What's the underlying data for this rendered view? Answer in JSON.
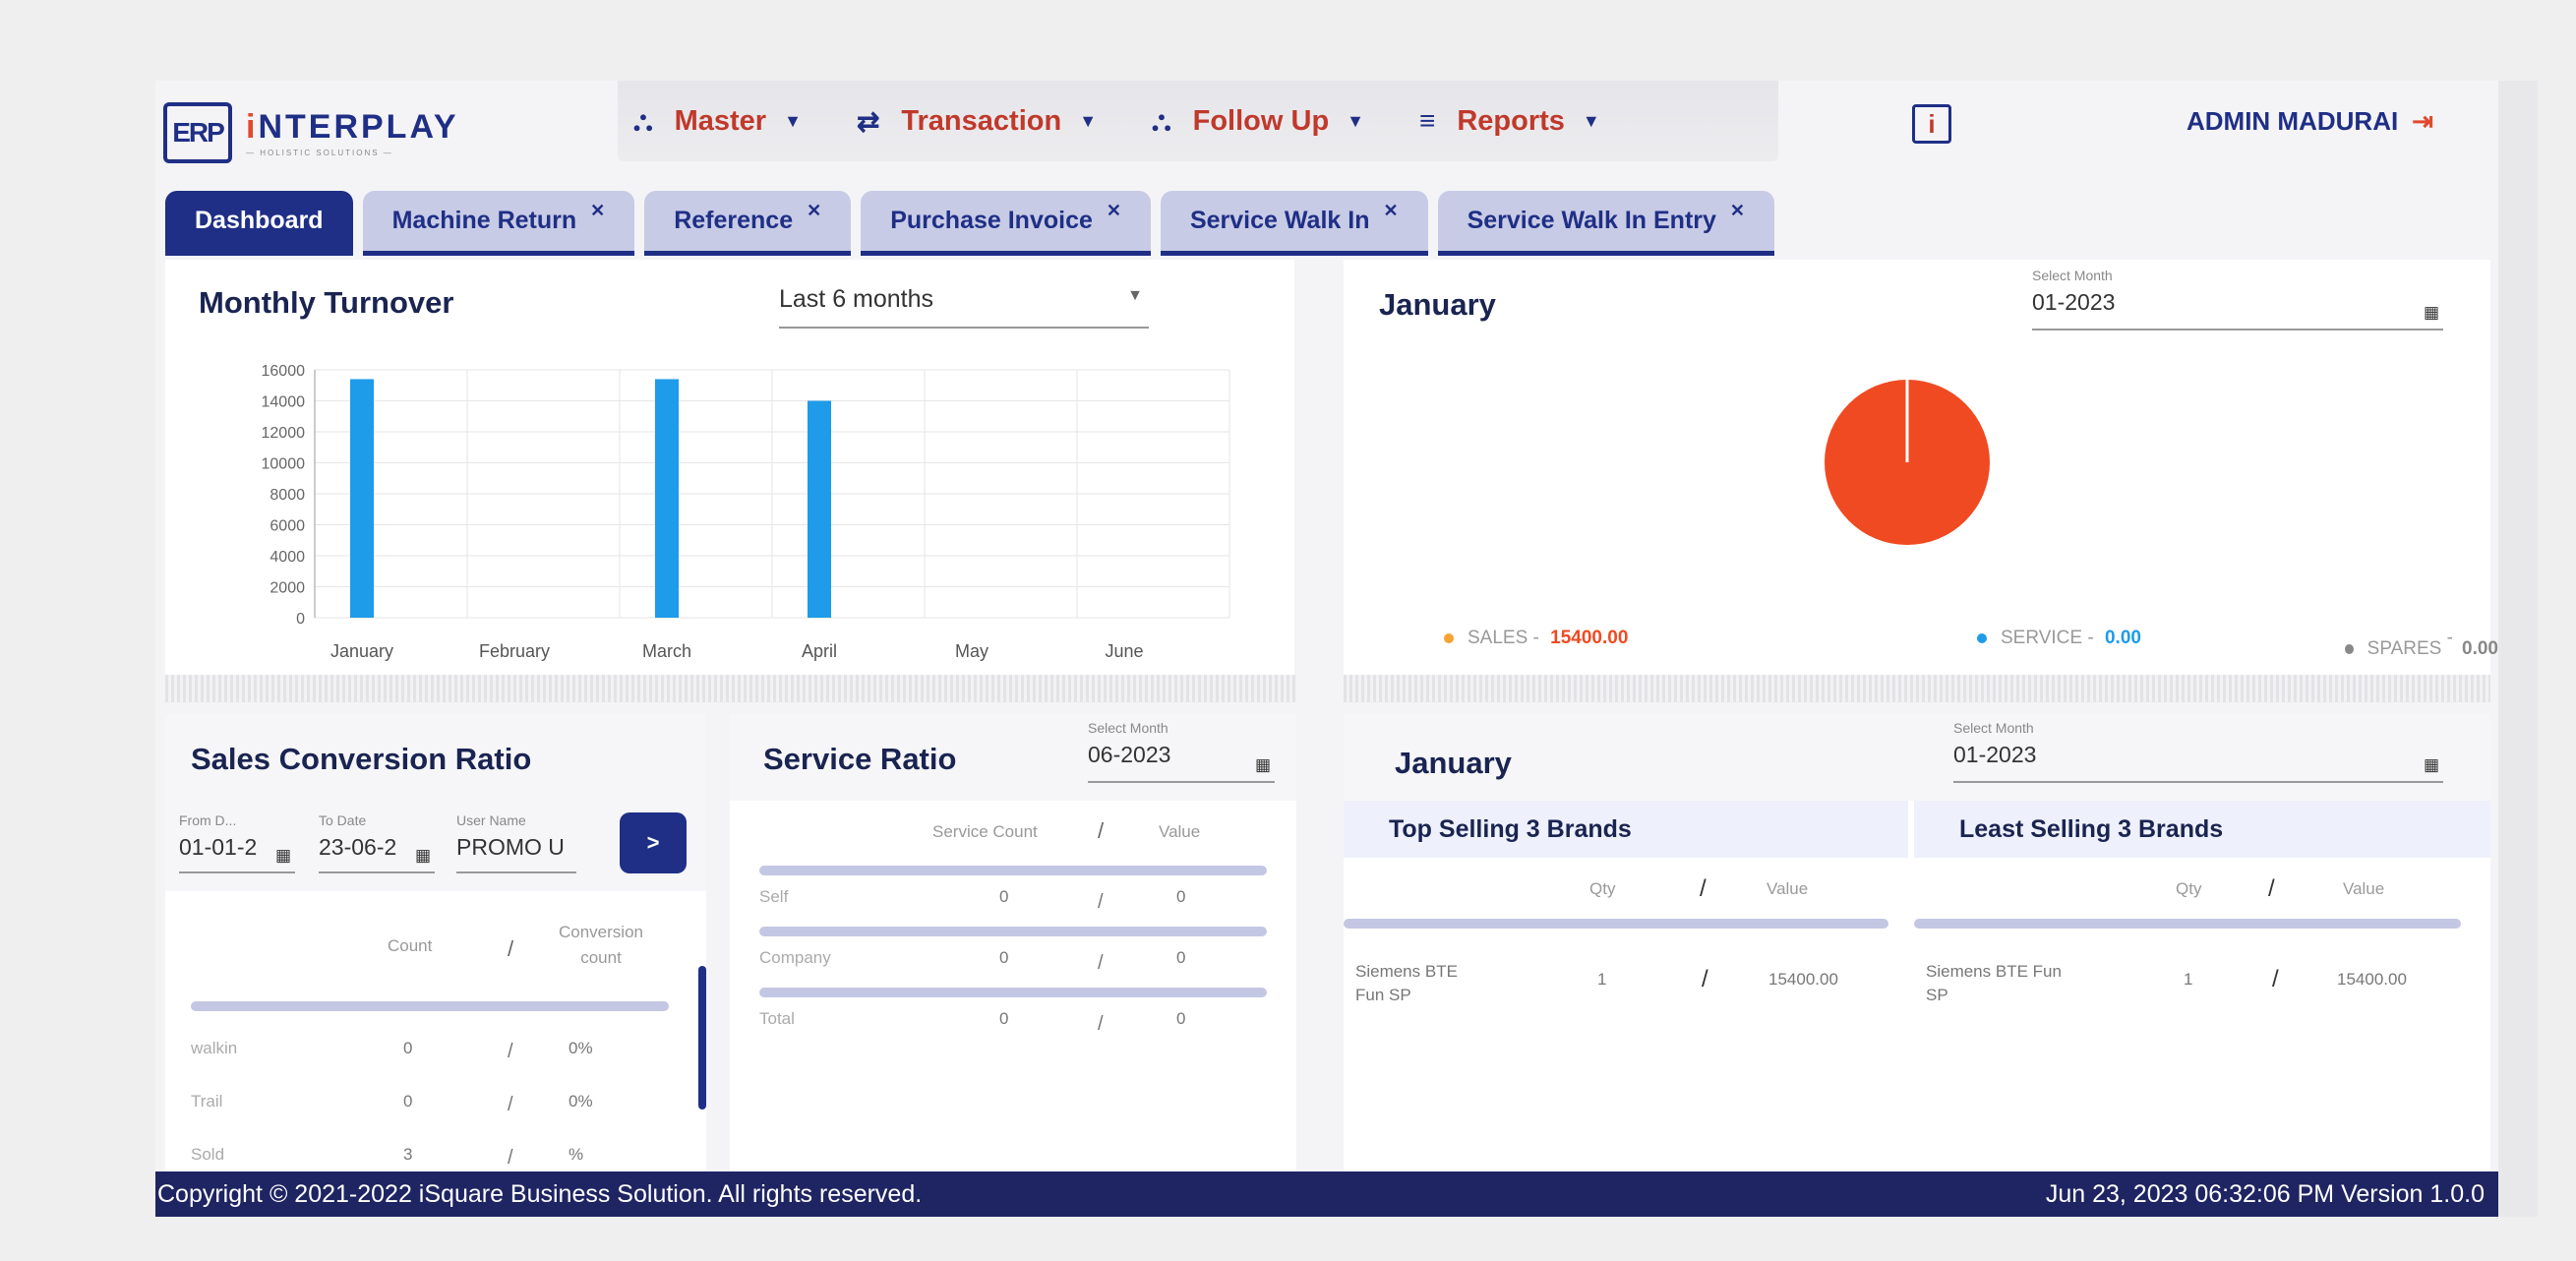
{
  "logo": {
    "name_pre": "i",
    "name_main": "NTERPLAY",
    "tagline": "— HOLISTIC SOLUTIONS —",
    "mark": "ERP"
  },
  "nav": [
    {
      "icon": "sitemap-icon",
      "glyph": "⛬",
      "label": "Master"
    },
    {
      "icon": "exchange-icon",
      "glyph": "⇄",
      "label": "Transaction"
    },
    {
      "icon": "sitemap-icon",
      "glyph": "⛬",
      "label": "Follow Up"
    },
    {
      "icon": "list-icon",
      "glyph": "≡",
      "label": "Reports"
    }
  ],
  "user": {
    "name": "ADMIN MADURAI"
  },
  "tabs": [
    {
      "label": "Dashboard",
      "active": true
    },
    {
      "label": "Machine Return"
    },
    {
      "label": "Reference"
    },
    {
      "label": "Purchase Invoice"
    },
    {
      "label": "Service Walk In"
    },
    {
      "label": "Service Walk In Entry"
    }
  ],
  "turnover": {
    "title": "Monthly Turnover",
    "period": "Last 6 months"
  },
  "chart_data": {
    "type": "bar",
    "categories": [
      "January",
      "February",
      "March",
      "April",
      "May",
      "June"
    ],
    "values": [
      15400,
      0,
      15400,
      14000,
      0,
      0
    ],
    "yticks": [
      0,
      2000,
      4000,
      6000,
      8000,
      10000,
      12000,
      14000,
      16000
    ],
    "ylim": [
      0,
      16000
    ],
    "color": "#1e9be9",
    "grid": true
  },
  "january_pie": {
    "title": "January",
    "month_label": "Select Month",
    "month": "01-2023",
    "slices": [
      {
        "name": "SALES",
        "value": "15400.00",
        "num": 15400,
        "color": "#f04a22",
        "dot": "#f7a233"
      },
      {
        "name": "SERVICE",
        "value": "0.00",
        "num": 0,
        "color": "#1e9be9",
        "dot": "#1e9be9"
      },
      {
        "name": "SPARES",
        "value": "0.00",
        "num": 0,
        "color": "#888888",
        "dot": "#888888"
      }
    ]
  },
  "sales_conversion": {
    "title": "Sales Conversion Ratio",
    "from_label": "From D...",
    "from_value": "01-01-2",
    "to_label": "To Date",
    "to_value": "23-06-2",
    "user_label": "User Name",
    "user_value": "PROMO U",
    "go": ">",
    "col_count": "Count",
    "col_sep": "/",
    "col_conv1": "Conversion",
    "col_conv2": "count",
    "rows": [
      {
        "name": "walkin",
        "count": "0",
        "conv": "0%"
      },
      {
        "name": "Trail",
        "count": "0",
        "conv": "0%"
      },
      {
        "name": "Sold",
        "count": "3",
        "conv": "%"
      }
    ]
  },
  "service_ratio": {
    "title": "Service Ratio",
    "month_label": "Select Month",
    "month": "06-2023",
    "col_count": "Service Count",
    "col_sep": "/",
    "col_value": "Value",
    "rows": [
      {
        "name": "Self",
        "count": "0",
        "value": "0"
      },
      {
        "name": "Company",
        "count": "0",
        "value": "0"
      },
      {
        "name": "Total",
        "count": "0",
        "value": "0"
      }
    ]
  },
  "brands": {
    "title": "January",
    "month_label": "Select Month",
    "month": "01-2023",
    "top_title": "Top Selling 3 Brands",
    "least_title": "Least Selling 3 Brands",
    "col_qty": "Qty",
    "col_sep": "/",
    "col_value": "Value",
    "top_rows": [
      {
        "name1": "Siemens BTE",
        "name2": "Fun SP",
        "qty": "1",
        "value": "15400.00"
      }
    ],
    "least_rows": [
      {
        "name1": "Siemens BTE Fun",
        "name2": "SP",
        "qty": "1",
        "value": "15400.00"
      }
    ]
  },
  "footer": {
    "copyright": "Copyright © 2021-2022 iSquare Business Solution. All rights reserved.",
    "datetime": "Jun 23, 2023 06:32:06 PM Version 1.0.0"
  }
}
